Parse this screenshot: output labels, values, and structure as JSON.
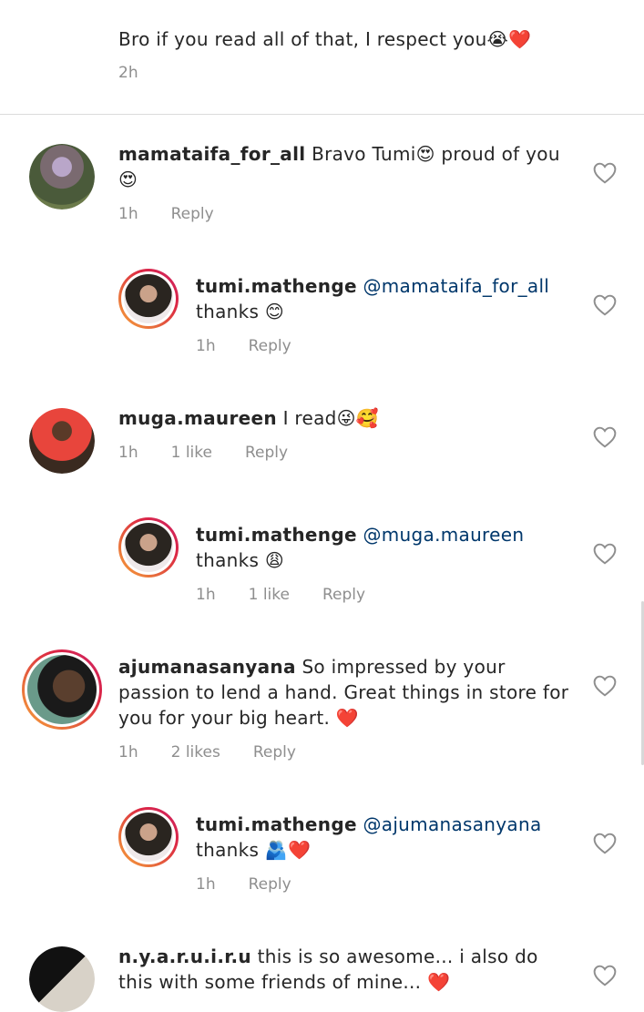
{
  "caption": {
    "text": "Bro if you read all of that, I respect you😭❤️",
    "time": "2h"
  },
  "comments": [
    {
      "username": "mamataifa_for_all",
      "mention": "",
      "text": " Bravo Tumi😍 proud of you 😍",
      "time": "1h",
      "likes": "",
      "reply": "Reply"
    },
    {
      "username": "tumi.mathenge",
      "mention": " @mamataifa_for_all",
      "text": " thanks 😊",
      "time": "1h",
      "likes": "",
      "reply": "Reply"
    },
    {
      "username": "muga.maureen",
      "mention": "",
      "text": " I read😜🥰",
      "time": "1h",
      "likes": "1 like",
      "reply": "Reply"
    },
    {
      "username": "tumi.mathenge",
      "mention": " @muga.maureen",
      "text": " thanks 😩",
      "time": "1h",
      "likes": "1 like",
      "reply": "Reply"
    },
    {
      "username": "ajumanasanyana",
      "mention": "",
      "text": " So impressed by your passion to lend a hand. Great things in store for you for your big heart. ❤️",
      "time": "1h",
      "likes": "2 likes",
      "reply": "Reply"
    },
    {
      "username": "tumi.mathenge",
      "mention": " @ajumanasanyana",
      "text": " thanks 🫂❤️",
      "time": "1h",
      "likes": "",
      "reply": "Reply"
    },
    {
      "username": "n.y.a.r.u.i.r.u",
      "mention": "",
      "text": " this is so awesome... i also do this with some friends of mine... ❤️",
      "time": "",
      "likes": "",
      "reply": ""
    }
  ],
  "icons": {
    "like": "heart-outline-icon"
  },
  "colors": {
    "mention": "#00376b",
    "meta": "#8e8e8e"
  }
}
